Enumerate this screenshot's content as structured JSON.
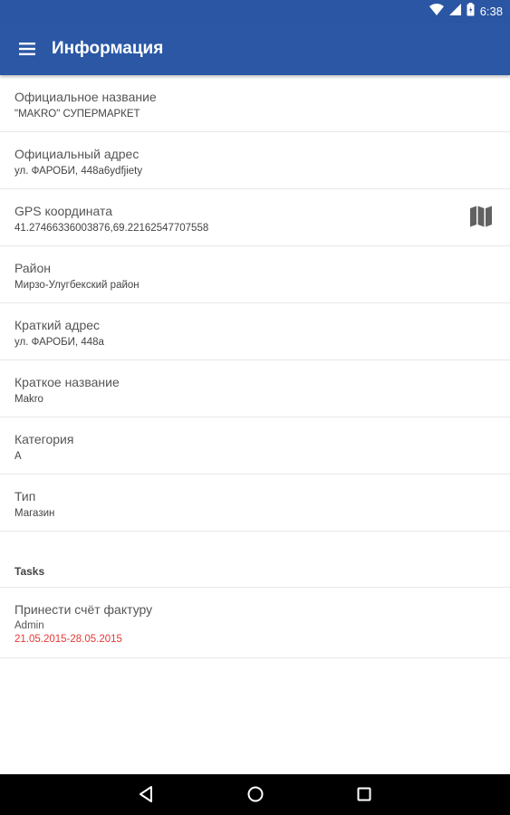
{
  "status_bar": {
    "time": "6:38",
    "icons": [
      "wifi-icon",
      "signal-icon",
      "battery-icon"
    ]
  },
  "app_bar": {
    "title": "Информация",
    "menu_icon": "hamburger-menu-icon",
    "color": "#2b57a5"
  },
  "info_rows": [
    {
      "label": "Официальное название",
      "value": "\"MAKRO\" СУПЕРМАРКЕТ"
    },
    {
      "label": "Официальный адрес",
      "value": "ул. ФАРОБИ, 448a6ydfjiety"
    },
    {
      "label": "GPS координата",
      "value": "41.27466336003876,69.22162547707558",
      "action_icon": "map-icon"
    },
    {
      "label": "Район",
      "value": "Мирзо-Улугбекский район"
    },
    {
      "label": "Краткий адрес",
      "value": "ул. ФАРОБИ, 448а"
    },
    {
      "label": "Краткое название",
      "value": "Makro"
    },
    {
      "label": "Категория",
      "value": "A"
    },
    {
      "label": "Тип",
      "value": "Магазин"
    }
  ],
  "tasks": {
    "header": "Tasks",
    "items": [
      {
        "title": "Принести счёт фактуру",
        "author": "Admin",
        "dates": "21.05.2015-28.05.2015",
        "date_color": "#e53935"
      }
    ]
  },
  "nav_bar": {
    "buttons": [
      "back-icon",
      "home-icon",
      "recents-icon"
    ]
  }
}
